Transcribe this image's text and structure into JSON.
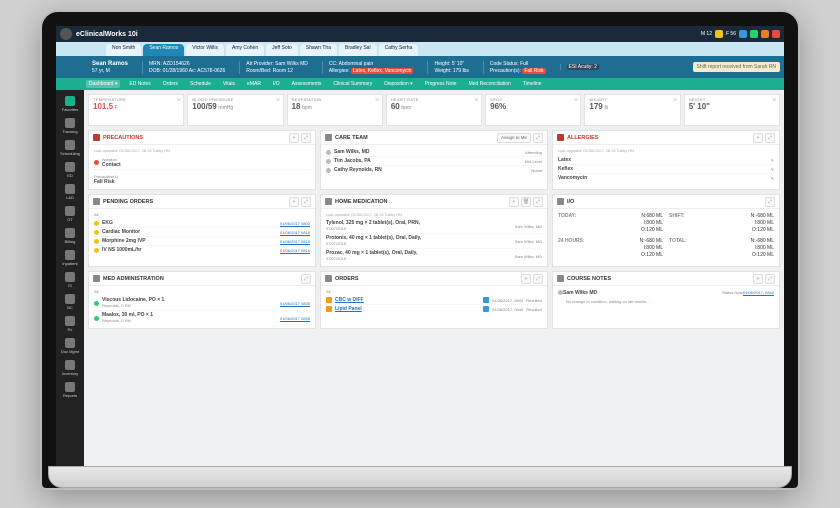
{
  "app": {
    "name": "eClinicalWorks 10i"
  },
  "patient_tabs": [
    {
      "label": "Non Smith"
    },
    {
      "label": "Sean Ramos",
      "active": true
    },
    {
      "label": "Victor Willis"
    },
    {
      "label": "Amy Cohen"
    },
    {
      "label": "Jeff Soto"
    },
    {
      "label": "Shawn Tha"
    },
    {
      "label": "Bradley Sal"
    },
    {
      "label": "Cathy Serha"
    }
  ],
  "banner": {
    "name": "Sean Ramos",
    "age_sex": "57 yr, M",
    "mrn_label": "MRN:",
    "mrn": "AZD154626",
    "dob_label": "DOB:",
    "dob": "01/28/1960",
    "acct_label": "Ac:",
    "acct": "AC578-0626",
    "provider_label": "Att Provider:",
    "provider": "Sam Wilks MD",
    "room_label": "Room/Bed:",
    "room": "Room 12",
    "cc_label": "CC:",
    "cc": "Abdominal pain",
    "allergies_label": "Allergies:",
    "allergies": "Latex, Keflex, Vancomycin",
    "height_label": "Height:",
    "height": "5' 10\"",
    "weight_label": "Weight:",
    "weight": "179 lbs",
    "code_label": "Code Status:",
    "code": "Full",
    "precautions_label": "Precaution(s):",
    "precautions": "Fall Risk",
    "esi_label": "ESI Acuity:",
    "esi": "2",
    "shift_note": "Shift report received from Sarah RN"
  },
  "ribbon": [
    "Dashboard",
    "ED Notes",
    "Orders",
    "Schedule",
    "Vitals",
    "eMAR",
    "I/O",
    "Assessments",
    "Clinical Summary",
    "Disposition",
    "Progress Note",
    "Med Reconciliation",
    "Timeline"
  ],
  "sidebar": [
    {
      "name": "favorites",
      "label": "Favorites"
    },
    {
      "name": "tracking",
      "label": "Tracking"
    },
    {
      "name": "scheduling",
      "label": "Scheduling"
    },
    {
      "name": "ed",
      "label": "ED"
    },
    {
      "name": "ld",
      "label": "L&D"
    },
    {
      "name": "ot",
      "label": "OT"
    },
    {
      "name": "billing",
      "label": "Billing"
    },
    {
      "name": "inpatient",
      "label": "Inpatient"
    },
    {
      "name": "is",
      "label": "IS"
    },
    {
      "name": "bc",
      "label": "BC"
    },
    {
      "name": "rx",
      "label": "Rx"
    },
    {
      "name": "docmgmt",
      "label": "Doc Mgmt"
    },
    {
      "name": "inventory",
      "label": "Inventory"
    },
    {
      "name": "reports",
      "label": "Reports"
    }
  ],
  "vitals": [
    {
      "label": "TEMPERATURE",
      "value": "101.5",
      "unit": "F",
      "alert": true
    },
    {
      "label": "BLOOD PRESSURE",
      "value": "100/59",
      "unit": "mmHg"
    },
    {
      "label": "RESPIRATION",
      "value": "18",
      "unit": "bpm"
    },
    {
      "label": "HEART RATE",
      "value": "60",
      "unit": "bpm"
    },
    {
      "label": "SpO2",
      "value": "96%",
      "unit": ""
    },
    {
      "label": "WEIGHT",
      "value": "179",
      "unit": "lb"
    },
    {
      "label": "HEIGHT",
      "value": "5' 10\"",
      "unit": ""
    }
  ],
  "cards": {
    "precautions": {
      "title": "PRECAUTIONS",
      "updated": "Last updated: 01/06/2017, 08:15  Cathy RN",
      "rows": [
        {
          "label": "Isolation",
          "value": "Contact"
        },
        {
          "label": "Precaution(s)",
          "value": "Fall Risk"
        }
      ]
    },
    "careteam": {
      "title": "CARE TEAM",
      "assign": "Assign to Me",
      "rows": [
        {
          "name": "Sam Wilks, MD",
          "role": "Attending"
        },
        {
          "name": "Tim Jacobs, PA",
          "role": "Mid-Level"
        },
        {
          "name": "Cathy Reynolds, RN",
          "role": "Nurse"
        }
      ]
    },
    "allergies": {
      "title": "ALLERGIES",
      "updated": "Last updated: 01/06/2017, 08:15  Cathy RN",
      "rows": [
        "Latex",
        "Keflex",
        "Vancomycin"
      ]
    },
    "pending": {
      "title": "PENDING ORDERS",
      "filter": "All",
      "rows": [
        {
          "name": "EKG",
          "date": "01/06/2017 0800"
        },
        {
          "name": "Cardiac Monitor",
          "date": "01/06/2017 0815"
        },
        {
          "name": "Morphine 2mg IVP",
          "date": "01/06/2017 0816"
        },
        {
          "name": "IV NS 1000mL/hr",
          "date": "01/06/2017 0816"
        }
      ]
    },
    "homemed": {
      "title": "HOME MEDICATION",
      "updated": "Last updated: 01/06/2017, 08:15  Cathy RN",
      "rows": [
        {
          "name": "Tylenol, 325 mg × 2 tablet(s), Oral, PRN,",
          "date": "07/07/2015",
          "by": "Sam Wilks, MD"
        },
        {
          "name": "Protonix, 40 mg × 1 tablet(s), Oral, Daily,",
          "date": "07/07/2015",
          "by": "Sam Wilks, MD"
        },
        {
          "name": "Prozac, 40 mg × 1 tablet(s), Oral, Daily,",
          "date": "07/07/2015",
          "by": "Sam Wilks, MD"
        }
      ]
    },
    "io": {
      "title": "I/O",
      "today_label": "TODAY:",
      "today": {
        "N": "N:680 ML",
        "I": "I:800 ML",
        "O": "O:120 ML"
      },
      "hrs_label": "24 HOURS:",
      "hrs": {
        "N": "N:-680 ML",
        "I": "I:800 ML",
        "O": "O:120 ML"
      },
      "shift_label": "SHIFT:",
      "shift": {
        "N": "N:-680 ML",
        "I": "I:800 ML",
        "O": "O:120 ML"
      },
      "total_label": "TOTAL:",
      "total": {
        "N": "N:-680 ML",
        "I": "I:800 ML",
        "O": "O:120 ML"
      }
    },
    "medadmin": {
      "title": "MED ADMINISTRATION",
      "filter": "All",
      "rows": [
        {
          "name": "Viscous Lidocaine, PO × 1",
          "by": "Reynolds, C RN",
          "date": "01/06/2017 0835"
        },
        {
          "name": "Maalox, 30 ml, PO × 1",
          "by": "Reynolds, C RN",
          "date": "01/06/2017 0835"
        }
      ]
    },
    "orders": {
      "title": "ORDERS",
      "filter": "All",
      "rows": [
        {
          "name": "CBC w DIFF",
          "date": "01/06/2017, 0840",
          "status": "Resulted"
        },
        {
          "name": "Lipid Panel",
          "date": "01/06/2017, 0840",
          "status": "Resulted"
        }
      ]
    },
    "course": {
      "title": "COURSE NOTES",
      "rows": [
        {
          "by": "Sam Wilks MD",
          "status": "Status Note",
          "date": "01/06/2017, 0840",
          "text": "No change in condition, waiting on lab results..."
        }
      ]
    }
  }
}
